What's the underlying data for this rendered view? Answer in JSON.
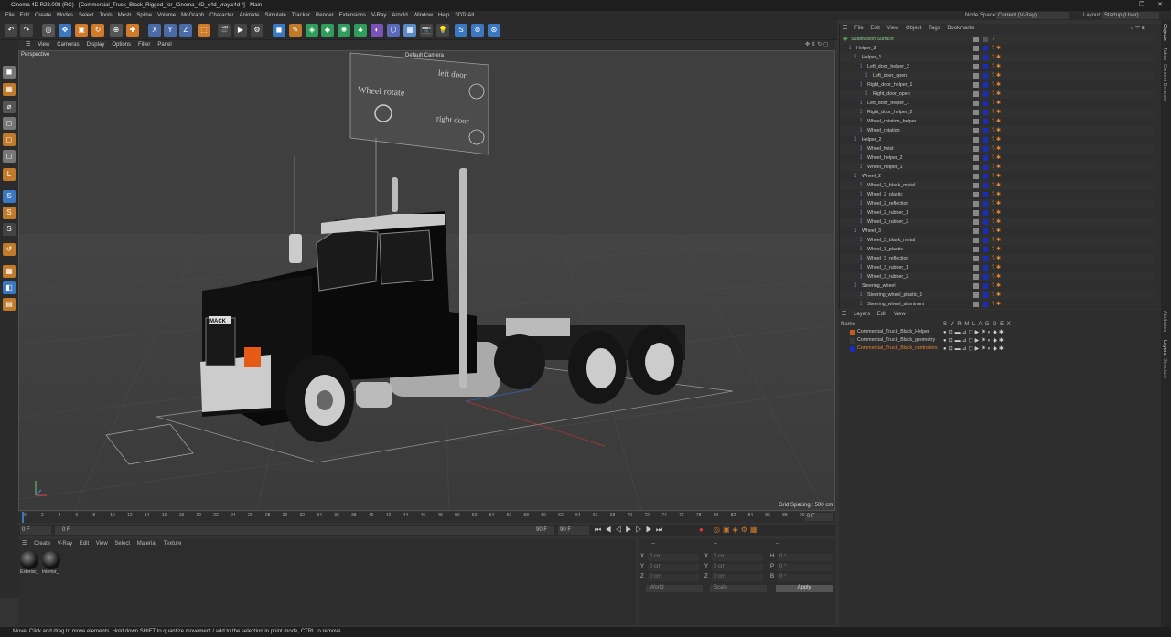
{
  "window": {
    "title": "Cinema 4D R23.008 (RC) - [Commercial_Truck_Black_Rigged_for_Cinema_4D_c4d_vray.c4d *] - Main",
    "minimize": "–",
    "maximize": "❐",
    "close": "✕"
  },
  "menu": [
    "File",
    "Edit",
    "Create",
    "Modes",
    "Select",
    "Tools",
    "Mesh",
    "Spline",
    "Volume",
    "MoGraph",
    "Character",
    "Animate",
    "Simulate",
    "Tracker",
    "Render",
    "Extensions",
    "V-Ray",
    "Arnold",
    "Window",
    "Help",
    "3DToAll"
  ],
  "node_space": {
    "label": "Node Space:",
    "value": "Current (V-Ray)"
  },
  "layout": {
    "label": "Layout:",
    "value": "Startup (User)"
  },
  "viewport": {
    "menu": [
      "View",
      "Cameras",
      "Display",
      "Options",
      "Filter",
      "Panel"
    ],
    "label": "Perspective",
    "camera": "Default Camera",
    "grid_spacing": "Grid Spacing : 500 cm",
    "rig_labels": {
      "wheel": "Wheel rotate",
      "left": "left door",
      "right": "right door"
    },
    "brand": "MACK"
  },
  "timeline": {
    "ticks": [
      "0",
      "2",
      "4",
      "6",
      "8",
      "10",
      "12",
      "14",
      "16",
      "18",
      "20",
      "22",
      "24",
      "26",
      "28",
      "30",
      "32",
      "34",
      "36",
      "38",
      "40",
      "42",
      "44",
      "46",
      "48",
      "50",
      "52",
      "54",
      "56",
      "58",
      "60",
      "62",
      "64",
      "66",
      "68",
      "70",
      "72",
      "74",
      "76",
      "78",
      "80",
      "82",
      "84",
      "86",
      "88",
      "90"
    ],
    "frame_right": "0 F"
  },
  "transport": {
    "start": "0 F",
    "current": "0 F",
    "end": "90 F",
    "end2": "90 F"
  },
  "materials": {
    "menu": [
      "Create",
      "V-Ray",
      "Edit",
      "View",
      "Select",
      "Material",
      "Texture"
    ],
    "items": [
      "Exterior_",
      "Interior_"
    ]
  },
  "coords": {
    "headers": [
      "--",
      "--",
      "--"
    ],
    "rows": [
      {
        "a": "X",
        "av": "0 cm",
        "b": "X",
        "bv": "0 cm",
        "c": "H",
        "cv": "0 °"
      },
      {
        "a": "Y",
        "av": "0 cm",
        "b": "Y",
        "bv": "0 cm",
        "c": "P",
        "cv": "0 °"
      },
      {
        "a": "Z",
        "av": "0 cm",
        "b": "Z",
        "bv": "0 cm",
        "c": "B",
        "cv": "0 °"
      }
    ],
    "mode1": "World",
    "mode2": "Scale",
    "apply": "Apply"
  },
  "objects": {
    "menu": [
      "File",
      "Edit",
      "View",
      "Object",
      "Tags",
      "Bookmarks"
    ],
    "rows": [
      {
        "name": "Subdivision Surface",
        "indent": 0
      },
      {
        "name": "Helper_3",
        "indent": 1
      },
      {
        "name": "Helper_1",
        "indent": 2
      },
      {
        "name": "Left_door_helper_2",
        "indent": 3
      },
      {
        "name": "Left_door_open",
        "indent": 4
      },
      {
        "name": "Right_door_helper_1",
        "indent": 3
      },
      {
        "name": "Right_door_open",
        "indent": 4
      },
      {
        "name": "Left_door_helper_1",
        "indent": 3
      },
      {
        "name": "Right_door_helper_2",
        "indent": 3
      },
      {
        "name": "Wheel_rotation_helper",
        "indent": 3
      },
      {
        "name": "Wheel_rotation",
        "indent": 3
      },
      {
        "name": "Helper_2",
        "indent": 2
      },
      {
        "name": "Wheel_twist",
        "indent": 3
      },
      {
        "name": "Wheel_helper_2",
        "indent": 3
      },
      {
        "name": "Wheel_helper_1",
        "indent": 3
      },
      {
        "name": "Wheel_2",
        "indent": 2
      },
      {
        "name": "Wheel_2_black_metal",
        "indent": 3
      },
      {
        "name": "Wheel_2_plastic",
        "indent": 3
      },
      {
        "name": "Wheel_2_reflection",
        "indent": 3
      },
      {
        "name": "Wheel_2_rubber_1",
        "indent": 3
      },
      {
        "name": "Wheel_2_rubber_2",
        "indent": 3
      },
      {
        "name": "Wheel_3",
        "indent": 2
      },
      {
        "name": "Wheel_3_black_metal",
        "indent": 3
      },
      {
        "name": "Wheel_3_plastic",
        "indent": 3
      },
      {
        "name": "Wheel_3_reflection",
        "indent": 3
      },
      {
        "name": "Wheel_3_rubber_1",
        "indent": 3
      },
      {
        "name": "Wheel_3_rubber_2",
        "indent": 3
      },
      {
        "name": "Steering_wheel",
        "indent": 2
      },
      {
        "name": "Steering_wheel_plastic_1",
        "indent": 3
      },
      {
        "name": "Steering_wheel_aluminum",
        "indent": 3
      }
    ]
  },
  "layers": {
    "menu": [
      "Layers",
      "Edit",
      "View"
    ],
    "header": "Name",
    "cols": "S V R M L A G D E X",
    "items": [
      {
        "name": "Commercial_Truck_Black_Helper",
        "color": "#c85a1e"
      },
      {
        "name": "Commercial_Truck_Black_geometry",
        "color": "#3a3a3a"
      },
      {
        "name": "Commercial_Truck_Black_controllers",
        "color": "#1a2cb8"
      }
    ]
  },
  "side_tabs": [
    "Objects",
    "Takes",
    "Content Browser",
    "Attributes",
    "Layers",
    "Structure"
  ],
  "status": "Move: Click and drag to move elements. Hold down SHIFT to quantize movement / add to the selection in point mode, CTRL to remove."
}
